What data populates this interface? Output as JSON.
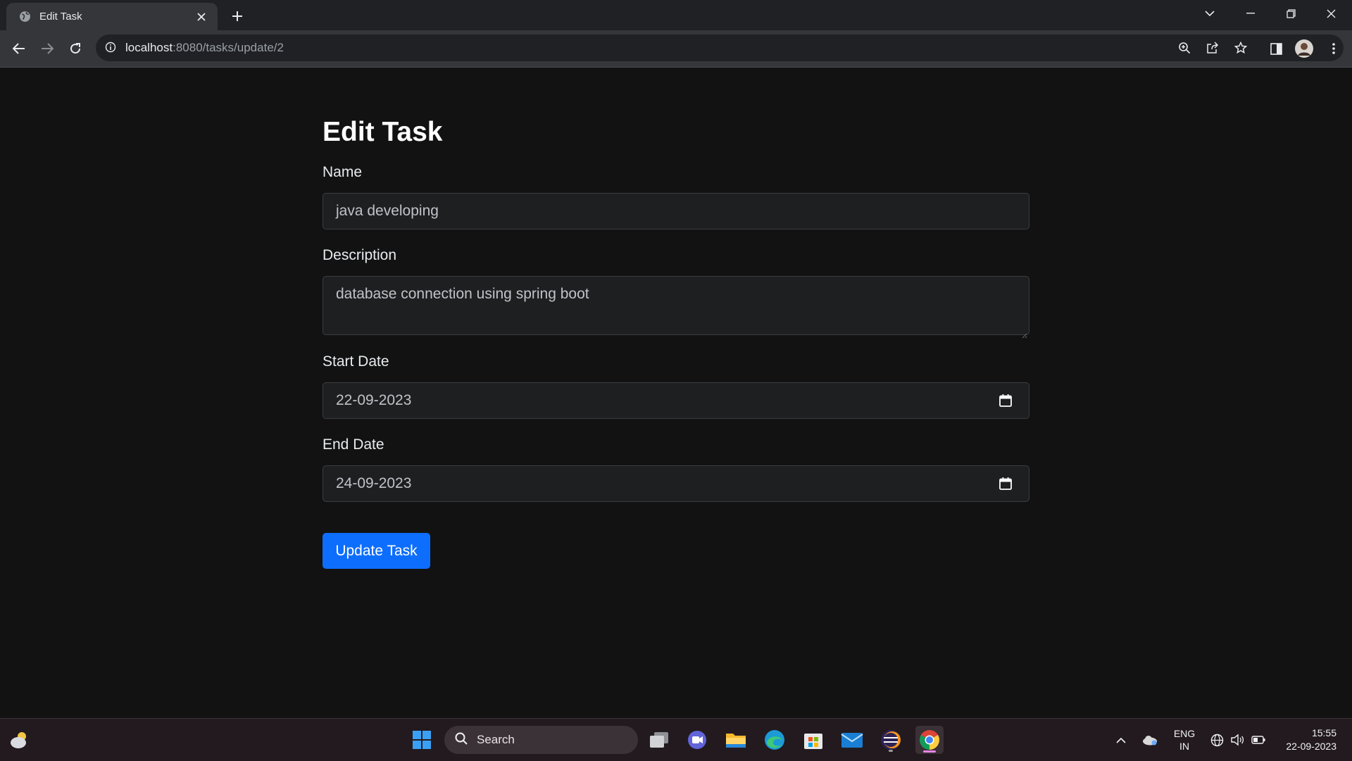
{
  "browser": {
    "tab_title": "Edit Task",
    "url_host": "localhost",
    "url_rest": ":8080/tasks/update/2"
  },
  "form": {
    "heading": "Edit Task",
    "name_label": "Name",
    "name_value": "java developing",
    "description_label": "Description",
    "description_value": "database connection using spring boot",
    "start_label": "Start Date",
    "start_value": "22-09-2023",
    "end_label": "End Date",
    "end_value": "24-09-2023",
    "submit_label": "Update Task"
  },
  "taskbar": {
    "search_label": "Search",
    "lang_line1": "ENG",
    "lang_line2": "IN",
    "time": "15:55",
    "date": "22-09-2023"
  },
  "colors": {
    "page_bg": "#121212",
    "primary_button": "#0d6efd",
    "browser_toolbar": "#35363a",
    "taskbar": "#221a1f"
  }
}
